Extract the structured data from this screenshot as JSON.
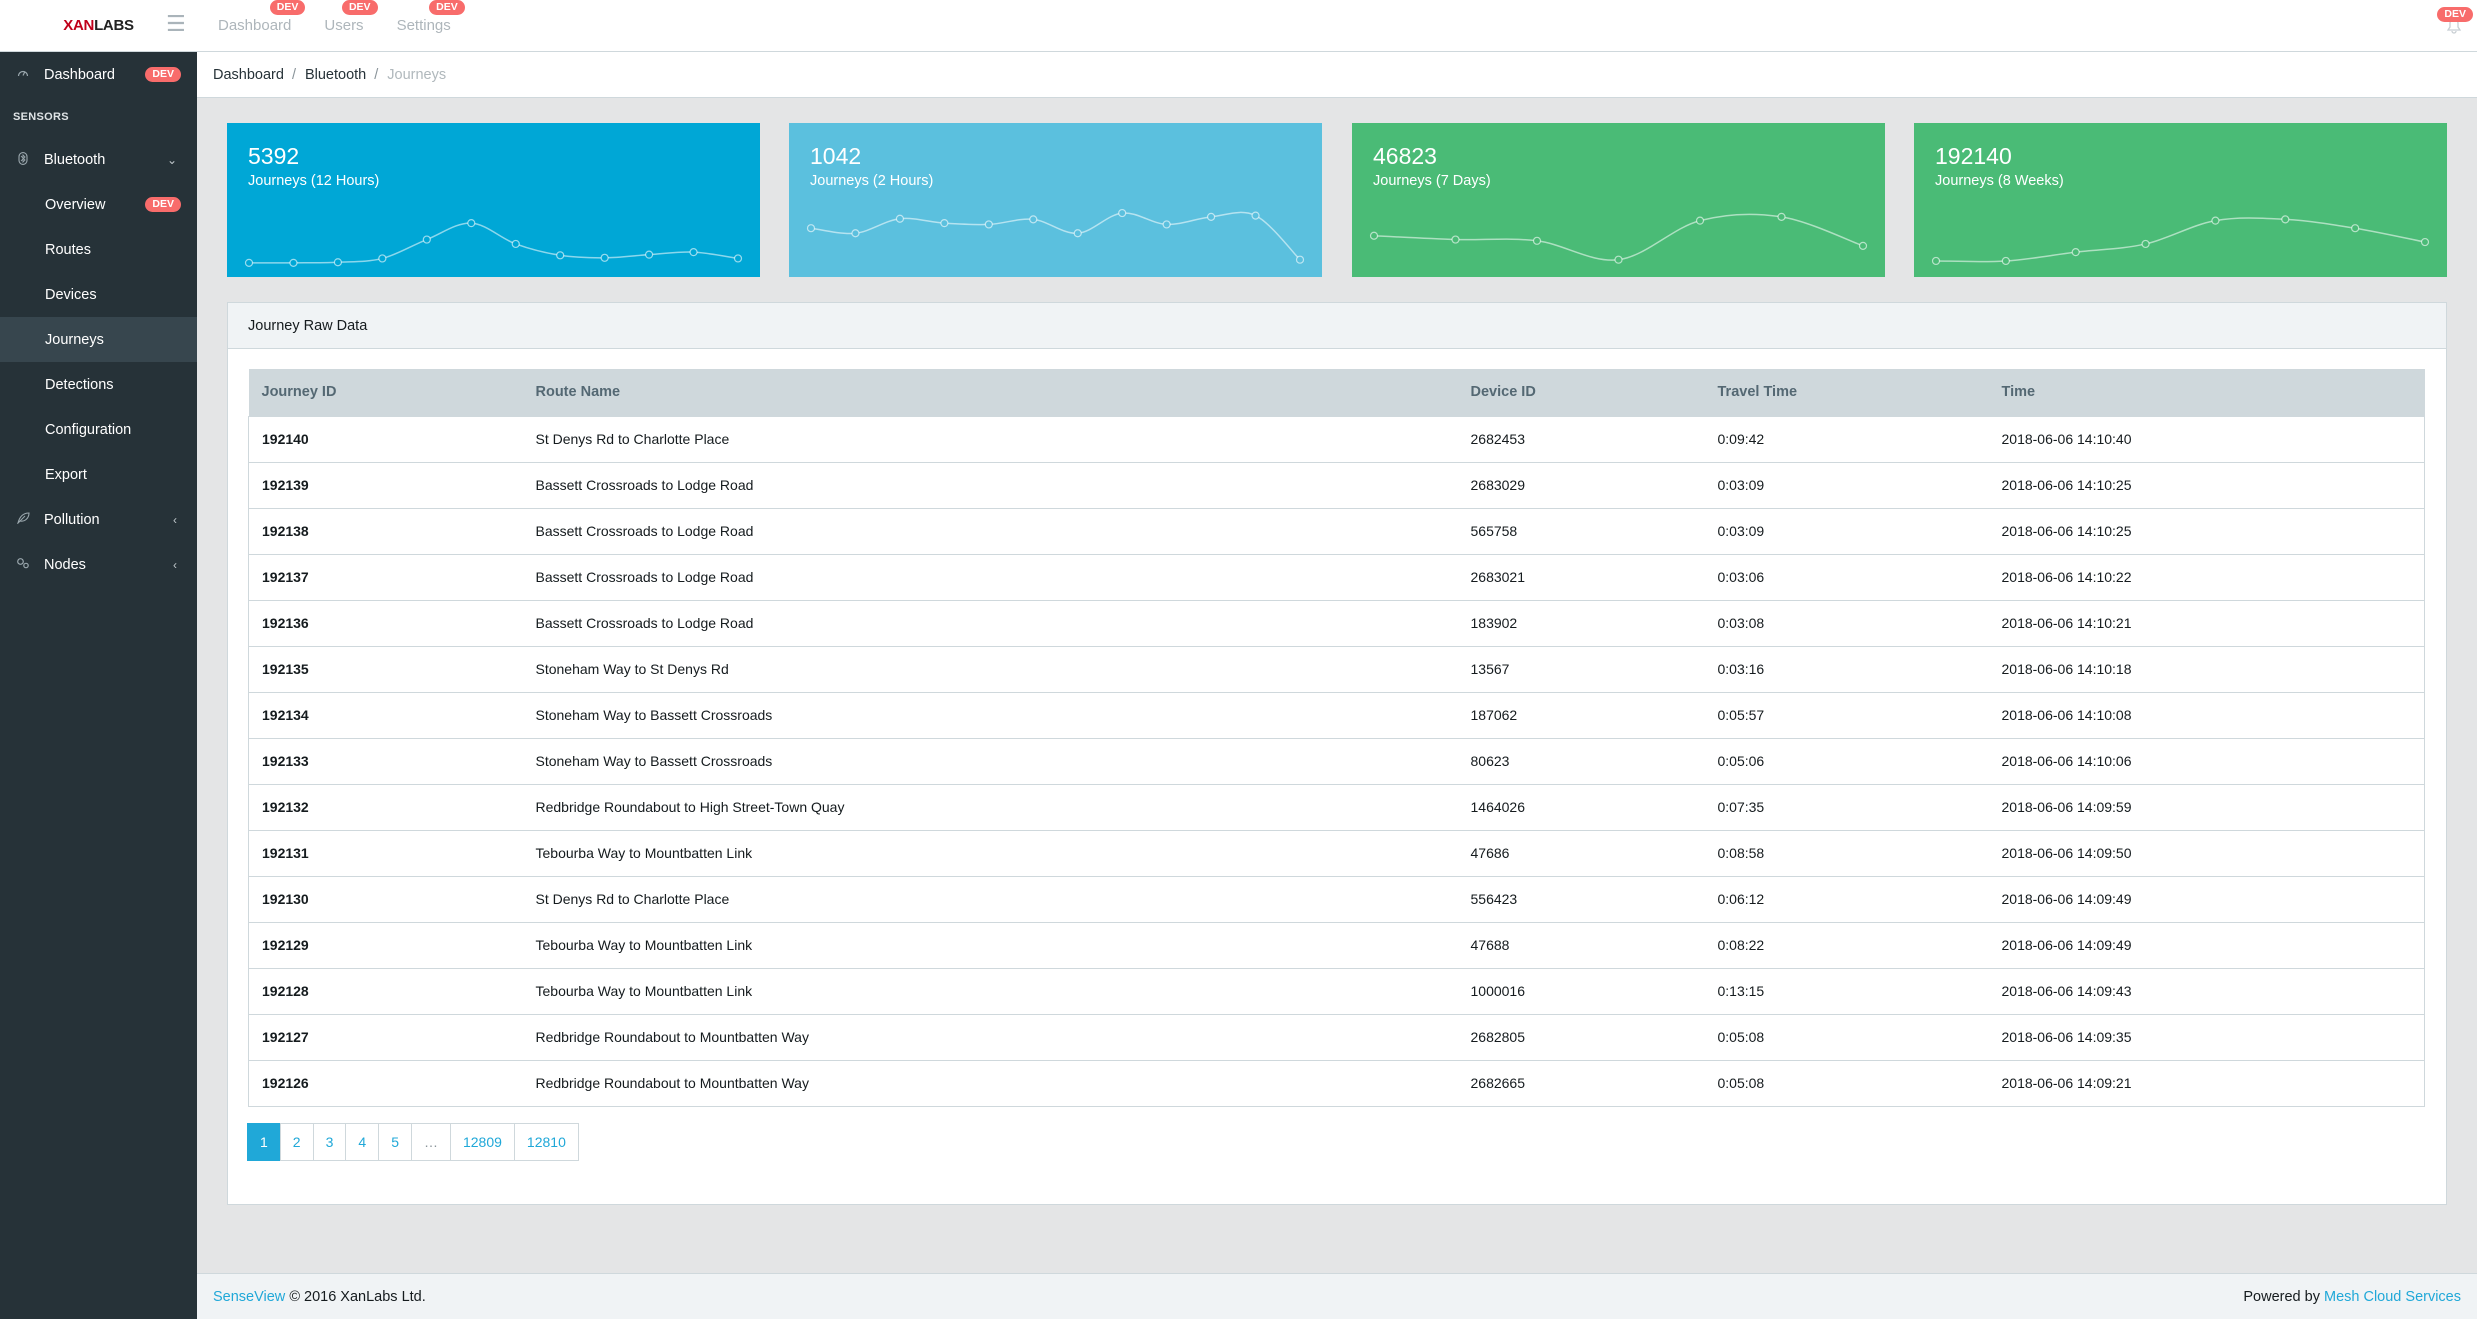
{
  "brand": {
    "part1": "XAN",
    "part2": "LABS"
  },
  "header": {
    "toggler_icon": "hamburger-icon",
    "nav": [
      {
        "label": "Dashboard",
        "badge": "DEV"
      },
      {
        "label": "Users",
        "badge": "DEV"
      },
      {
        "label": "Settings",
        "badge": "DEV"
      }
    ],
    "notification_badge": "DEV"
  },
  "sidebar": {
    "dashboard": {
      "label": "Dashboard",
      "badge": "DEV"
    },
    "section_title": "SENSORS",
    "bluetooth": {
      "label": "Bluetooth"
    },
    "bluetooth_children": [
      {
        "label": "Overview",
        "badge": "DEV"
      },
      {
        "label": "Routes"
      },
      {
        "label": "Devices"
      },
      {
        "label": "Journeys"
      },
      {
        "label": "Detections"
      },
      {
        "label": "Configuration"
      },
      {
        "label": "Export"
      }
    ],
    "pollution": {
      "label": "Pollution"
    },
    "nodes": {
      "label": "Nodes"
    }
  },
  "breadcrumb": [
    "Dashboard",
    "Bluetooth",
    "Journeys"
  ],
  "stats": [
    {
      "value": "5392",
      "label": "Journeys (12 Hours)",
      "color": "#00a7d6",
      "trend": [
        0.05,
        0.05,
        0.06,
        0.12,
        0.42,
        0.68,
        0.35,
        0.17,
        0.13,
        0.18,
        0.22,
        0.12
      ]
    },
    {
      "value": "1042",
      "label": "Journeys (2 Hours)",
      "color": "#5bc0de",
      "trend": [
        0.6,
        0.52,
        0.75,
        0.68,
        0.66,
        0.74,
        0.52,
        0.84,
        0.66,
        0.78,
        0.8,
        0.1
      ]
    },
    {
      "value": "46823",
      "label": "Journeys (7 Days)",
      "color": "#4abb76",
      "trend": [
        0.48,
        0.42,
        0.4,
        0.1,
        0.72,
        0.78,
        0.32
      ]
    },
    {
      "value": "192140",
      "label": "Journeys (8 Weeks)",
      "color": "#4abb76",
      "trend": [
        0.08,
        0.08,
        0.22,
        0.35,
        0.72,
        0.74,
        0.6,
        0.38
      ]
    }
  ],
  "table": {
    "title": "Journey Raw Data",
    "columns": [
      "Journey ID",
      "Route Name",
      "Device ID",
      "Travel Time",
      "Time"
    ],
    "rows": [
      [
        "192140",
        "St Denys Rd to Charlotte Place",
        "2682453",
        "0:09:42",
        "2018-06-06 14:10:40"
      ],
      [
        "192139",
        "Bassett Crossroads to Lodge Road",
        "2683029",
        "0:03:09",
        "2018-06-06 14:10:25"
      ],
      [
        "192138",
        "Bassett Crossroads to Lodge Road",
        "565758",
        "0:03:09",
        "2018-06-06 14:10:25"
      ],
      [
        "192137",
        "Bassett Crossroads to Lodge Road",
        "2683021",
        "0:03:06",
        "2018-06-06 14:10:22"
      ],
      [
        "192136",
        "Bassett Crossroads to Lodge Road",
        "183902",
        "0:03:08",
        "2018-06-06 14:10:21"
      ],
      [
        "192135",
        "Stoneham Way to St Denys Rd",
        "13567",
        "0:03:16",
        "2018-06-06 14:10:18"
      ],
      [
        "192134",
        "Stoneham Way to Bassett Crossroads",
        "187062",
        "0:05:57",
        "2018-06-06 14:10:08"
      ],
      [
        "192133",
        "Stoneham Way to Bassett Crossroads",
        "80623",
        "0:05:06",
        "2018-06-06 14:10:06"
      ],
      [
        "192132",
        "Redbridge Roundabout to High Street-Town Quay",
        "1464026",
        "0:07:35",
        "2018-06-06 14:09:59"
      ],
      [
        "192131",
        "Tebourba Way to Mountbatten Link",
        "47686",
        "0:08:58",
        "2018-06-06 14:09:50"
      ],
      [
        "192130",
        "St Denys Rd to Charlotte Place",
        "556423",
        "0:06:12",
        "2018-06-06 14:09:49"
      ],
      [
        "192129",
        "Tebourba Way to Mountbatten Link",
        "47688",
        "0:08:22",
        "2018-06-06 14:09:49"
      ],
      [
        "192128",
        "Tebourba Way to Mountbatten Link",
        "1000016",
        "0:13:15",
        "2018-06-06 14:09:43"
      ],
      [
        "192127",
        "Redbridge Roundabout to Mountbatten Way",
        "2682805",
        "0:05:08",
        "2018-06-06 14:09:35"
      ],
      [
        "192126",
        "Redbridge Roundabout to Mountbatten Way",
        "2682665",
        "0:05:08",
        "2018-06-06 14:09:21"
      ]
    ]
  },
  "pagination": [
    "1",
    "2",
    "3",
    "4",
    "5",
    "…",
    "12809",
    "12810"
  ],
  "pagination_active": "1",
  "footer": {
    "product_link": "SenseView",
    "copyright": "© 2016 XanLabs Ltd.",
    "powered_by": "Powered by",
    "powered_link": "Mesh Cloud Services"
  }
}
